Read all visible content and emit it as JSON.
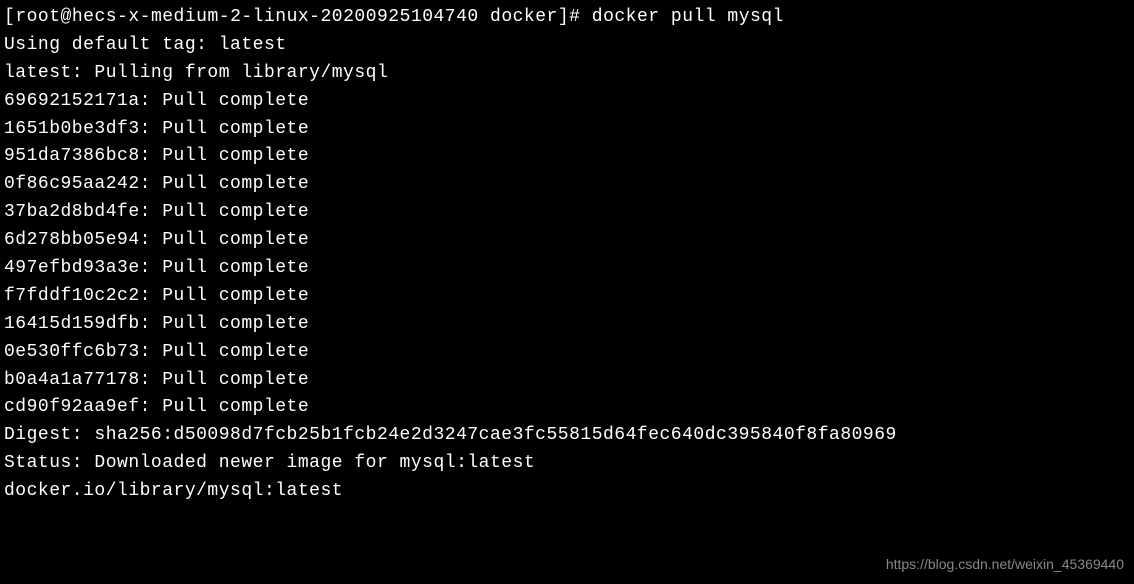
{
  "prompt": {
    "user": "root",
    "host": "hecs-x-medium-2-linux-20200925104740",
    "cwd": "docker",
    "symbol": "#",
    "command": "docker pull mysql"
  },
  "output": {
    "tag_line": "Using default tag: latest",
    "blank": "",
    "pulling_line": "latest: Pulling from library/mysql",
    "layers": [
      {
        "id": "69692152171a",
        "status": "Pull complete"
      },
      {
        "id": "1651b0be3df3",
        "status": "Pull complete"
      },
      {
        "id": "951da7386bc8",
        "status": "Pull complete"
      },
      {
        "id": "0f86c95aa242",
        "status": "Pull complete"
      },
      {
        "id": "37ba2d8bd4fe",
        "status": "Pull complete"
      },
      {
        "id": "6d278bb05e94",
        "status": "Pull complete"
      },
      {
        "id": "497efbd93a3e",
        "status": "Pull complete"
      },
      {
        "id": "f7fddf10c2c2",
        "status": "Pull complete"
      },
      {
        "id": "16415d159dfb",
        "status": "Pull complete"
      },
      {
        "id": "0e530ffc6b73",
        "status": "Pull complete"
      },
      {
        "id": "b0a4a1a77178",
        "status": "Pull complete"
      },
      {
        "id": "cd90f92aa9ef",
        "status": "Pull complete"
      }
    ],
    "digest_line": "Digest: sha256:d50098d7fcb25b1fcb24e2d3247cae3fc55815d64fec640dc395840f8fa80969",
    "status_line": "Status: Downloaded newer image for mysql:latest",
    "image_ref": "docker.io/library/mysql:latest"
  },
  "watermark": "https://blog.csdn.net/weixin_45369440"
}
